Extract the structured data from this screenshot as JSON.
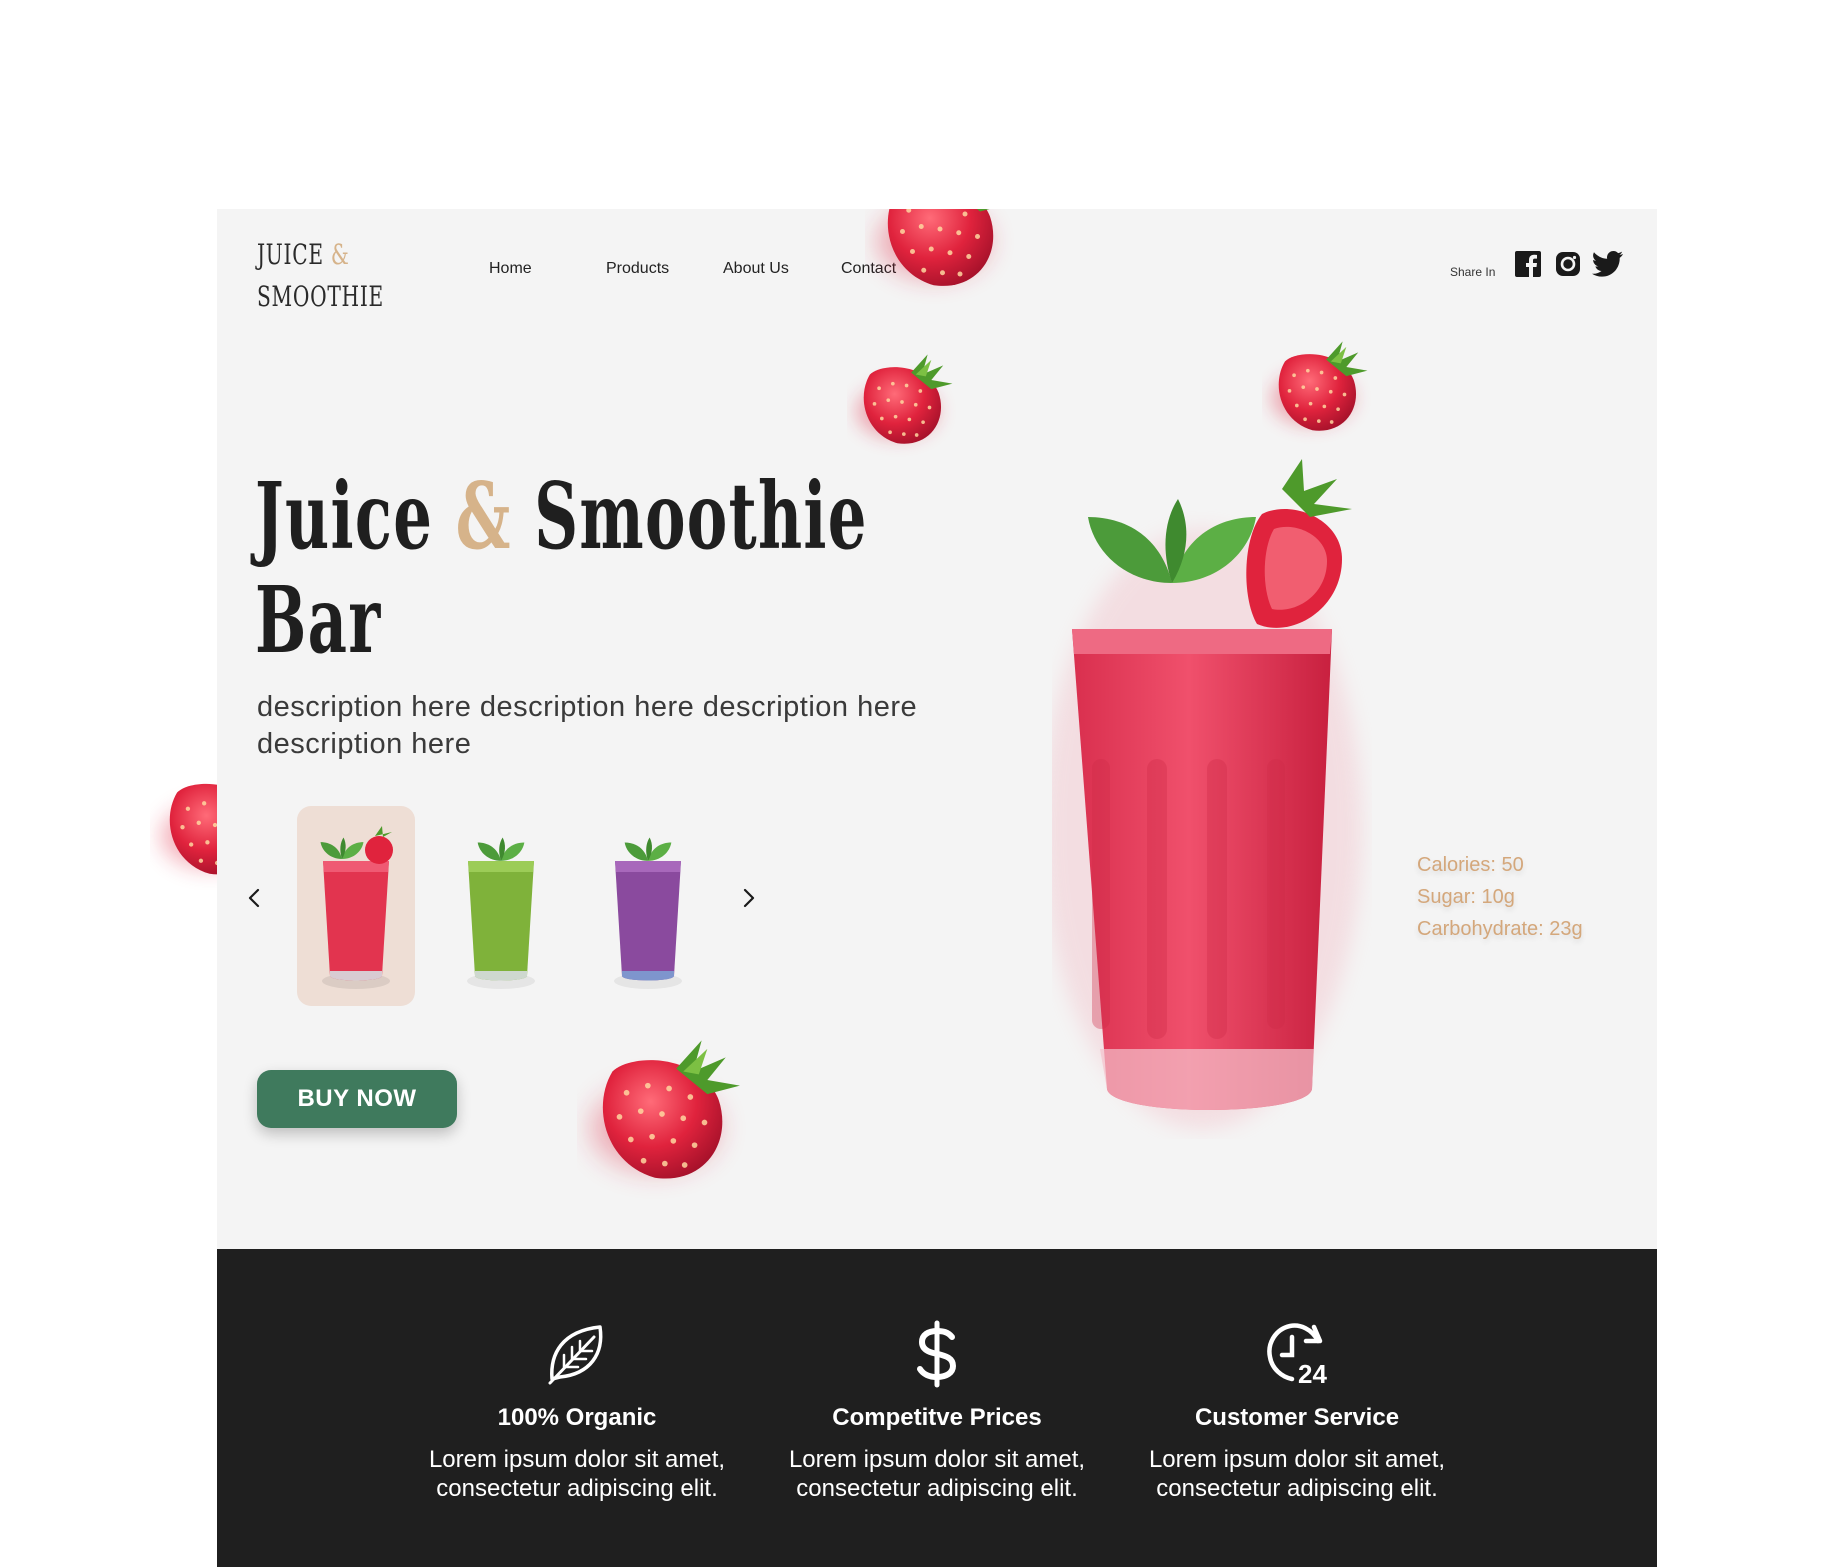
{
  "logo": {
    "line1": "JUICE",
    "amp": "&",
    "line2": "SMOOTHIE"
  },
  "nav": {
    "items": [
      "Home",
      "Products",
      "About Us",
      "Contact"
    ]
  },
  "share": {
    "label": "Share In",
    "icons": [
      "facebook-icon",
      "instagram-icon",
      "twitter-icon"
    ]
  },
  "hero": {
    "title_part1": "Juice ",
    "title_amp": "&",
    "title_part2": " Smoothie",
    "title_line2": "Bar",
    "description": "description here description here description here description here",
    "buy_label": "BUY NOW"
  },
  "carousel": {
    "items": [
      {
        "name": "strawberry",
        "color": "#e2344f"
      },
      {
        "name": "green",
        "color": "#7fb23a"
      },
      {
        "name": "berry",
        "color": "#8a4a9e"
      }
    ],
    "selected": 0
  },
  "nutrition": {
    "calories": "Calories: 50",
    "sugar": "Sugar: 10g",
    "carbs": "Carbohydrate:  23g"
  },
  "features": [
    {
      "icon": "leaf-icon",
      "title": "100% Organic",
      "text": "Lorem ipsum dolor sit amet, consectetur adipiscing elit."
    },
    {
      "icon": "dollar-icon",
      "title": "Competitve Prices",
      "text": "Lorem ipsum dolor sit amet, consectetur adipiscing elit."
    },
    {
      "icon": "clock-24-icon",
      "title": "Customer Service",
      "text": "Lorem ipsum dolor sit amet, consectetur adipiscing elit."
    }
  ],
  "colors": {
    "accent": "#d6b38a",
    "button": "#3f7a5d",
    "footer": "#1f1f1f",
    "nutrition": "#d4a77b"
  }
}
